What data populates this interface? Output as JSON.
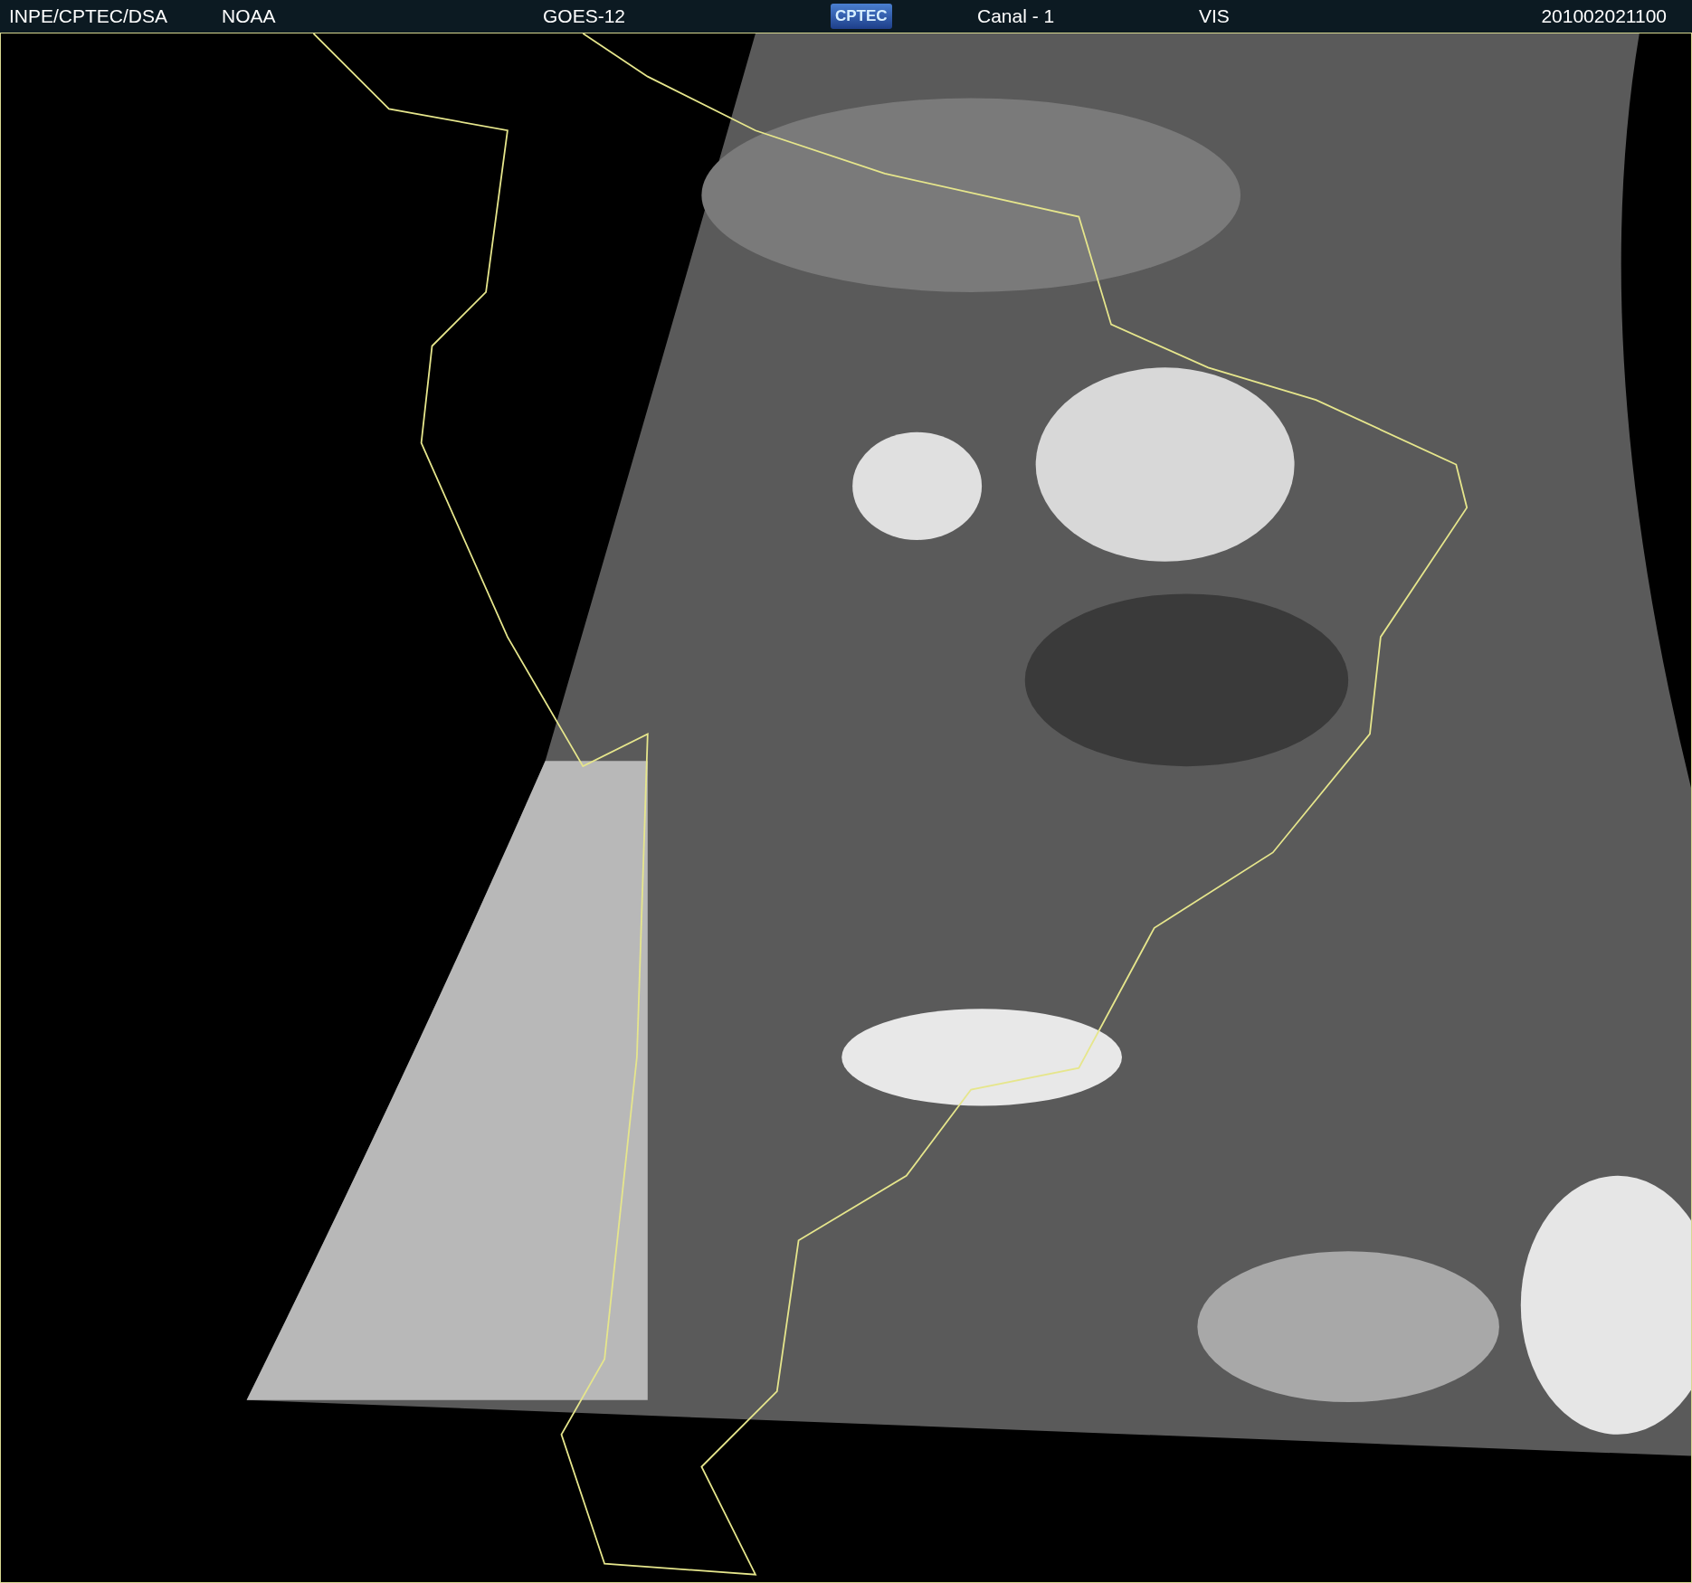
{
  "header": {
    "items": [
      {
        "kind": "text",
        "text": "INPE/CPTEC/DSA"
      },
      {
        "kind": "text",
        "text": "NOAA"
      },
      {
        "kind": "text",
        "text": "GOES-12"
      },
      {
        "kind": "logo",
        "text": "CPTEC"
      },
      {
        "kind": "text",
        "text": "Canal - 1"
      },
      {
        "kind": "text",
        "text": "VIS"
      },
      {
        "kind": "text",
        "text": "201002021100"
      }
    ]
  }
}
